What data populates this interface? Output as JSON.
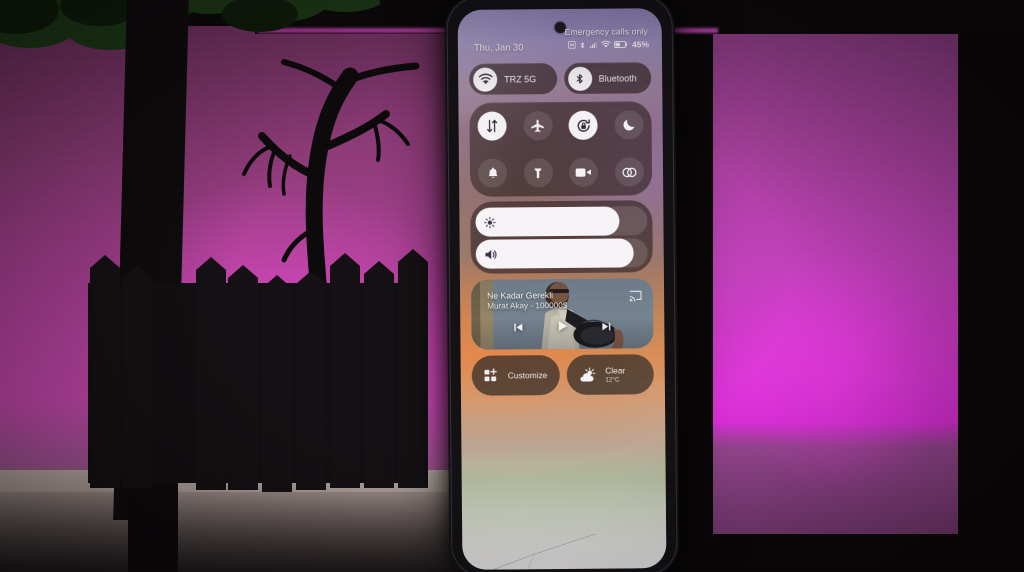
{
  "scene": {
    "description": "photo of a smartphone showing Android quick settings panel, standing on a shelf in front of a magenta backlit panel with dark tree and fence silhouettes",
    "colors": {
      "wall_magenta": "#c240bb",
      "panel_bright": "#e22fe0",
      "silhouette_black": "#0d0a0c",
      "floor_beige": "#b9aba5"
    }
  },
  "phone": {
    "status_bar": {
      "carrier_text": "Emergency calls only",
      "date": "Thu, Jan 30",
      "battery_percent": "45%",
      "icons": [
        "nfc-icon",
        "bluetooth-icon",
        "signal-bars-icon",
        "wifi-icon",
        "battery-icon"
      ]
    },
    "connectivity_pills": [
      {
        "label": "TRZ 5G",
        "icon": "wifi-icon",
        "active": true
      },
      {
        "label": "Bluetooth",
        "icon": "bluetooth-icon",
        "active": true
      }
    ],
    "toggles": [
      {
        "name": "mobile-data",
        "icon": "mobile-data-icon",
        "active": true
      },
      {
        "name": "airplane-mode",
        "icon": "airplane-icon",
        "active": false
      },
      {
        "name": "auto-rotate",
        "icon": "rotate-lock-icon",
        "active": true
      },
      {
        "name": "dark-mode",
        "icon": "moon-icon",
        "active": false
      },
      {
        "name": "ring-mode",
        "icon": "bell-icon",
        "active": false
      },
      {
        "name": "flashlight",
        "icon": "flashlight-icon",
        "active": false
      },
      {
        "name": "screen-record",
        "icon": "video-camera-icon",
        "active": false
      },
      {
        "name": "cast-link",
        "icon": "link-icon",
        "active": false
      }
    ],
    "sliders": [
      {
        "name": "brightness",
        "icon": "brightness-icon",
        "value": 84
      },
      {
        "name": "volume",
        "icon": "volume-icon",
        "value": 92
      }
    ],
    "media": {
      "title": "Ne Kadar Gerekli",
      "artist_album": "Murat Akay - 100000$",
      "cast_icon": "cast-icon",
      "controls": [
        "previous-track-icon",
        "play-icon",
        "next-track-icon"
      ],
      "playing": false
    },
    "bottom_buttons": [
      {
        "name": "customize",
        "label": "Customize",
        "icon": "grid-plus-icon",
        "sub": ""
      },
      {
        "name": "weather",
        "label": "Clear",
        "icon": "sun-cloud-icon",
        "sub": "12°C"
      }
    ]
  }
}
